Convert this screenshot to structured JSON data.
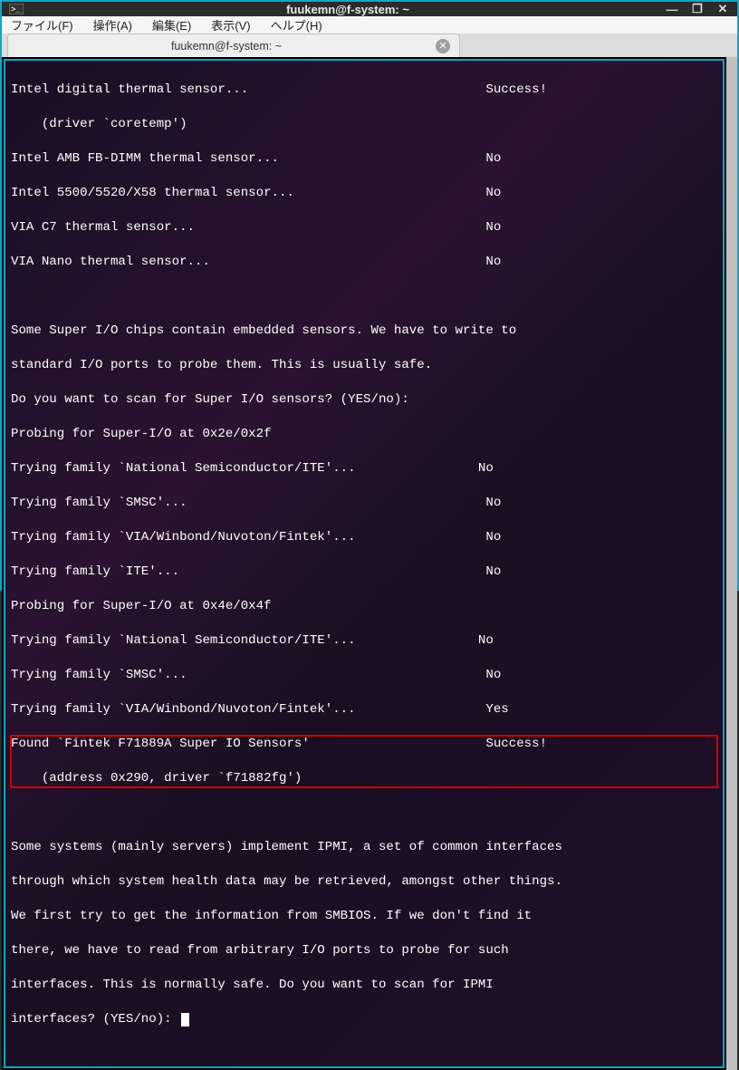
{
  "window": {
    "title": "fuukemn@f-system: ~"
  },
  "menu": {
    "file": "ファイル(F)",
    "action": "操作(A)",
    "edit": "編集(E)",
    "view": "表示(V)",
    "help": "ヘルプ(H)"
  },
  "tab": {
    "label": "fuukemn@f-system: ~"
  },
  "term": {
    "l01": "Intel digital thermal sensor...                               Success!",
    "l02": "    (driver `coretemp')",
    "l03": "Intel AMB FB-DIMM thermal sensor...                           No",
    "l04": "Intel 5500/5520/X58 thermal sensor...                         No",
    "l05": "VIA C7 thermal sensor...                                      No",
    "l06": "VIA Nano thermal sensor...                                    No",
    "l07": " ",
    "l08": "Some Super I/O chips contain embedded sensors. We have to write to",
    "l09": "standard I/O ports to probe them. This is usually safe.",
    "l10": "Do you want to scan for Super I/O sensors? (YES/no):",
    "l11": "Probing for Super-I/O at 0x2e/0x2f",
    "l12": "Trying family `National Semiconductor/ITE'...                No",
    "l13": "Trying family `SMSC'...                                       No",
    "l14": "Trying family `VIA/Winbond/Nuvoton/Fintek'...                 No",
    "l15": "Trying family `ITE'...                                        No",
    "l16": "Probing for Super-I/O at 0x4e/0x4f",
    "l17": "Trying family `National Semiconductor/ITE'...                No",
    "l18": "Trying family `SMSC'...                                       No",
    "l19": "Trying family `VIA/Winbond/Nuvoton/Fintek'...                 Yes",
    "l20": "Found `Fintek F71889A Super IO Sensors'                       Success!",
    "l21": "    (address 0x290, driver `f71882fg')",
    "l22": " ",
    "l23": "Some systems (mainly servers) implement IPMI, a set of common interfaces",
    "l24": "through which system health data may be retrieved, amongst other things.",
    "l25": "We first try to get the information from SMBIOS. If we don't find it",
    "l26": "there, we have to read from arbitrary I/O ports to probe for such",
    "l27": "interfaces. This is normally safe. Do you want to scan for IPMI",
    "l28": "interfaces? (YES/no): "
  }
}
